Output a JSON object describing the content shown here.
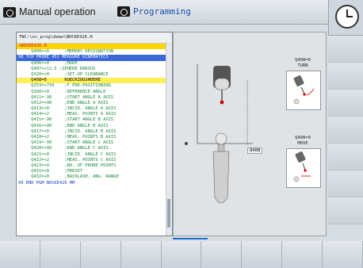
{
  "header": {
    "mode_manual": "Manual operation",
    "mode_programming": "Programming"
  },
  "program": {
    "path": "TNC:\\nc_prog\\demo\\NOCKE426.H",
    "lines": [
      "→NOCKE426.H",
      "     Q406=+0      ;MEMORY DESIGNATION",
      "98 TCH PROBE 451 MEASURE KINEMATICS",
      "     Q406=+0      ;MODE",
      "     Q407=+12.5 ;SPHERE RADIUS",
      "     Q320=+0      ;SET-UP CLEARANCE",
      "     Q408=0       RUECKZUGSHOEHE",
      "     Q253=+750    ;F PRE-POSITIONING",
      "     Q380=+0      ;REFERENCE ANGLE",
      "     Q411=-90     ;START ANGLE A AXIS",
      "     Q412=+90     ;END ANGLE A AXIS",
      "     Q413=+0      ;INCID. ANGLE A AXIS",
      "     Q414=+2      ;MEAS. POINTS A AXIS",
      "     Q415=-90     ;START ANGLE B AXIS",
      "     Q416=+90     ;END ANGLE B AXIS",
      "     Q417=+0      ;INCID. ANGLE B AXIS",
      "     Q418=+2      ;MEAS. POINTS B AXIS",
      "     Q419=-90     ;START ANGLE C AXIS",
      "     Q420=+90     ;END ANGLE C AXIS",
      "     Q421=+0      ;INCID. ANGLE C AXIS",
      "     Q422=+2      ;MEAS. POINTS C AXIS",
      "     Q423=+4      ;NO. OF PROBE POINTS",
      "     Q431=+0      ;PRESET",
      "     Q432=+0      ;BACKLASH, ANG. RANGE",
      "99 END PGM NOCKE426 MM"
    ]
  },
  "graphic": {
    "param": "Q408",
    "turn_label_top": "Q408=0",
    "turn_label_bottom": "TURN",
    "move_label_top": "Q408=0",
    "move_label_bottom": "MOVE"
  }
}
